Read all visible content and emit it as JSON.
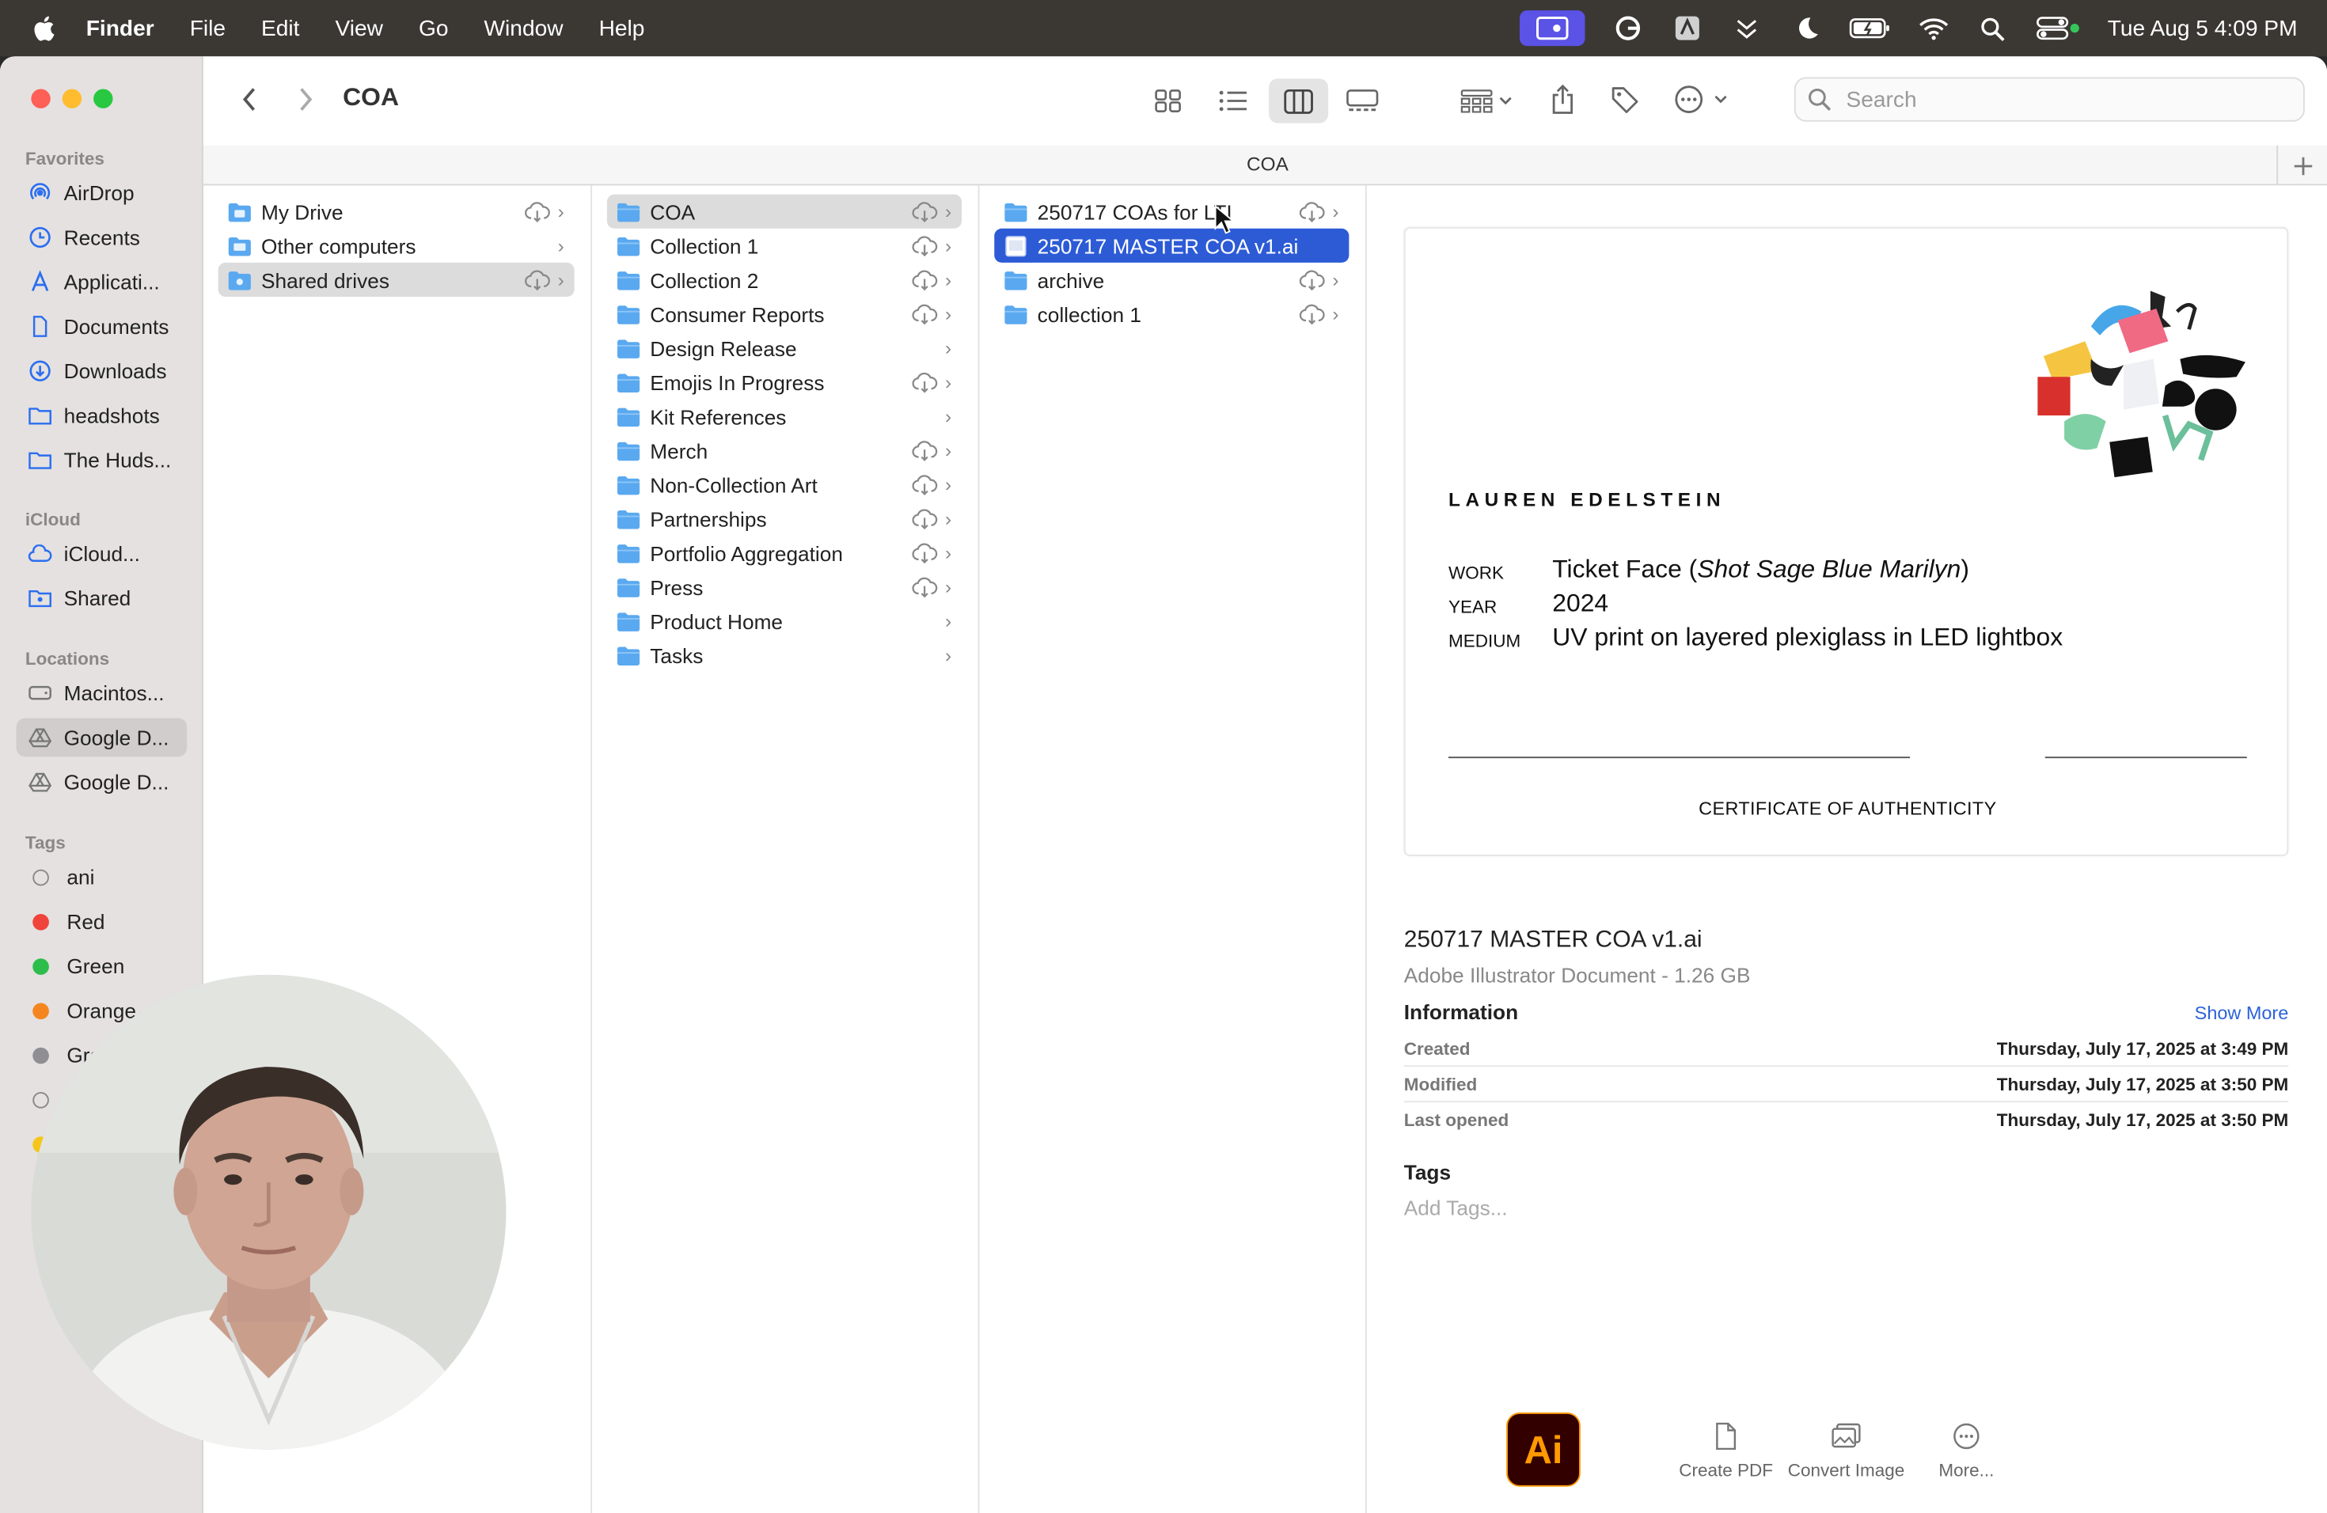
{
  "menubar": {
    "app": "Finder",
    "items": [
      "File",
      "Edit",
      "View",
      "Go",
      "Window",
      "Help"
    ],
    "clock": "Tue Aug 5  4:09 PM"
  },
  "toolbar": {
    "title": "COA",
    "search_placeholder": "Search"
  },
  "pathbar": {
    "title": "COA"
  },
  "sidebar": {
    "favorites_header": "Favorites",
    "favorites": [
      "AirDrop",
      "Recents",
      "Applicati...",
      "Documents",
      "Downloads",
      "headshots",
      "The Huds..."
    ],
    "icloud_header": "iCloud",
    "icloud": [
      "iCloud...",
      "Shared"
    ],
    "locations_header": "Locations",
    "locations": [
      "Macintos...",
      "Google D...",
      "Google D..."
    ],
    "tags_header": "Tags",
    "tags": [
      {
        "name": "ani",
        "color": ""
      },
      {
        "name": "Red",
        "color": "#f0433a"
      },
      {
        "name": "Green",
        "color": "#2dbd4a"
      },
      {
        "name": "Orange",
        "color": "#f5861f"
      },
      {
        "name": "Gra",
        "color": "#8e8e93"
      }
    ]
  },
  "columns": {
    "col1": [
      "My Drive",
      "Other computers",
      "Shared drives"
    ],
    "col2": [
      "COA",
      "Collection 1",
      "Collection 2",
      "Consumer Reports",
      "Design Release",
      "Emojis In Progress",
      "Kit References",
      "Merch",
      "Non-Collection Art",
      "Partnerships",
      "Portfolio Aggregation",
      "Press",
      "Product Home",
      "Tasks"
    ],
    "col3": [
      "250717 COAs for LTI",
      "250717 MASTER COA v1.ai",
      "archive",
      "collection 1"
    ]
  },
  "preview": {
    "artist": "LAUREN EDELSTEIN",
    "work_label": "WORK",
    "work_value_prefix": "Ticket Face (",
    "work_value_italic": "Shot Sage Blue Marilyn",
    "work_value_suffix": ")",
    "year_label": "YEAR",
    "year_value": "2024",
    "medium_label": "MEDIUM",
    "medium_value": "UV print on layered plexiglass in LED lightbox",
    "certificate": "CERTIFICATE OF AUTHENTICITY",
    "file_name": "250717 MASTER COA v1.ai",
    "file_type": "Adobe Illustrator Document - 1.26 GB",
    "info_header": "Information",
    "show_more": "Show More",
    "info": [
      {
        "k": "Created",
        "v": "Thursday, July 17, 2025 at 3:49 PM"
      },
      {
        "k": "Modified",
        "v": "Thursday, July 17, 2025 at 3:50 PM"
      },
      {
        "k": "Last opened",
        "v": "Thursday, July 17, 2025 at 3:50 PM"
      }
    ],
    "tags_header": "Tags",
    "add_tags": "Add Tags...",
    "app_icon": "Ai",
    "actions": [
      "Create PDF",
      "Convert Image",
      "More..."
    ]
  }
}
